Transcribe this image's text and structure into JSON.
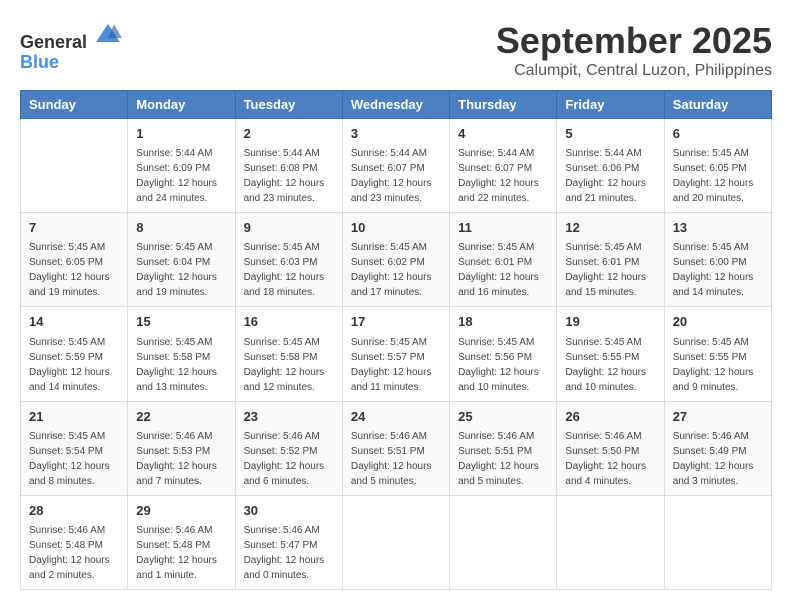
{
  "logo": {
    "general": "General",
    "blue": "Blue"
  },
  "title": "September 2025",
  "subtitle": "Calumpit, Central Luzon, Philippines",
  "days_of_week": [
    "Sunday",
    "Monday",
    "Tuesday",
    "Wednesday",
    "Thursday",
    "Friday",
    "Saturday"
  ],
  "weeks": [
    [
      {
        "day": "",
        "info": ""
      },
      {
        "day": "1",
        "info": "Sunrise: 5:44 AM\nSunset: 6:09 PM\nDaylight: 12 hours\nand 24 minutes."
      },
      {
        "day": "2",
        "info": "Sunrise: 5:44 AM\nSunset: 6:08 PM\nDaylight: 12 hours\nand 23 minutes."
      },
      {
        "day": "3",
        "info": "Sunrise: 5:44 AM\nSunset: 6:07 PM\nDaylight: 12 hours\nand 23 minutes."
      },
      {
        "day": "4",
        "info": "Sunrise: 5:44 AM\nSunset: 6:07 PM\nDaylight: 12 hours\nand 22 minutes."
      },
      {
        "day": "5",
        "info": "Sunrise: 5:44 AM\nSunset: 6:06 PM\nDaylight: 12 hours\nand 21 minutes."
      },
      {
        "day": "6",
        "info": "Sunrise: 5:45 AM\nSunset: 6:05 PM\nDaylight: 12 hours\nand 20 minutes."
      }
    ],
    [
      {
        "day": "7",
        "info": "Sunrise: 5:45 AM\nSunset: 6:05 PM\nDaylight: 12 hours\nand 19 minutes."
      },
      {
        "day": "8",
        "info": "Sunrise: 5:45 AM\nSunset: 6:04 PM\nDaylight: 12 hours\nand 19 minutes."
      },
      {
        "day": "9",
        "info": "Sunrise: 5:45 AM\nSunset: 6:03 PM\nDaylight: 12 hours\nand 18 minutes."
      },
      {
        "day": "10",
        "info": "Sunrise: 5:45 AM\nSunset: 6:02 PM\nDaylight: 12 hours\nand 17 minutes."
      },
      {
        "day": "11",
        "info": "Sunrise: 5:45 AM\nSunset: 6:01 PM\nDaylight: 12 hours\nand 16 minutes."
      },
      {
        "day": "12",
        "info": "Sunrise: 5:45 AM\nSunset: 6:01 PM\nDaylight: 12 hours\nand 15 minutes."
      },
      {
        "day": "13",
        "info": "Sunrise: 5:45 AM\nSunset: 6:00 PM\nDaylight: 12 hours\nand 14 minutes."
      }
    ],
    [
      {
        "day": "14",
        "info": "Sunrise: 5:45 AM\nSunset: 5:59 PM\nDaylight: 12 hours\nand 14 minutes."
      },
      {
        "day": "15",
        "info": "Sunrise: 5:45 AM\nSunset: 5:58 PM\nDaylight: 12 hours\nand 13 minutes."
      },
      {
        "day": "16",
        "info": "Sunrise: 5:45 AM\nSunset: 5:58 PM\nDaylight: 12 hours\nand 12 minutes."
      },
      {
        "day": "17",
        "info": "Sunrise: 5:45 AM\nSunset: 5:57 PM\nDaylight: 12 hours\nand 11 minutes."
      },
      {
        "day": "18",
        "info": "Sunrise: 5:45 AM\nSunset: 5:56 PM\nDaylight: 12 hours\nand 10 minutes."
      },
      {
        "day": "19",
        "info": "Sunrise: 5:45 AM\nSunset: 5:55 PM\nDaylight: 12 hours\nand 10 minutes."
      },
      {
        "day": "20",
        "info": "Sunrise: 5:45 AM\nSunset: 5:55 PM\nDaylight: 12 hours\nand 9 minutes."
      }
    ],
    [
      {
        "day": "21",
        "info": "Sunrise: 5:45 AM\nSunset: 5:54 PM\nDaylight: 12 hours\nand 8 minutes."
      },
      {
        "day": "22",
        "info": "Sunrise: 5:46 AM\nSunset: 5:53 PM\nDaylight: 12 hours\nand 7 minutes."
      },
      {
        "day": "23",
        "info": "Sunrise: 5:46 AM\nSunset: 5:52 PM\nDaylight: 12 hours\nand 6 minutes."
      },
      {
        "day": "24",
        "info": "Sunrise: 5:46 AM\nSunset: 5:51 PM\nDaylight: 12 hours\nand 5 minutes."
      },
      {
        "day": "25",
        "info": "Sunrise: 5:46 AM\nSunset: 5:51 PM\nDaylight: 12 hours\nand 5 minutes."
      },
      {
        "day": "26",
        "info": "Sunrise: 5:46 AM\nSunset: 5:50 PM\nDaylight: 12 hours\nand 4 minutes."
      },
      {
        "day": "27",
        "info": "Sunrise: 5:46 AM\nSunset: 5:49 PM\nDaylight: 12 hours\nand 3 minutes."
      }
    ],
    [
      {
        "day": "28",
        "info": "Sunrise: 5:46 AM\nSunset: 5:48 PM\nDaylight: 12 hours\nand 2 minutes."
      },
      {
        "day": "29",
        "info": "Sunrise: 5:46 AM\nSunset: 5:48 PM\nDaylight: 12 hours\nand 1 minute."
      },
      {
        "day": "30",
        "info": "Sunrise: 5:46 AM\nSunset: 5:47 PM\nDaylight: 12 hours\nand 0 minutes."
      },
      {
        "day": "",
        "info": ""
      },
      {
        "day": "",
        "info": ""
      },
      {
        "day": "",
        "info": ""
      },
      {
        "day": "",
        "info": ""
      }
    ]
  ]
}
